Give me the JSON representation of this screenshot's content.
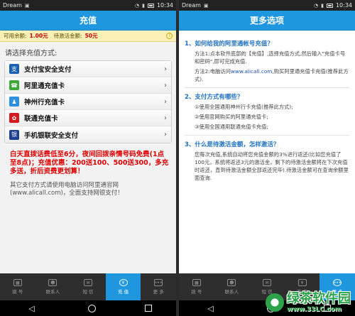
{
  "left": {
    "status": {
      "carrier": "Dream",
      "time": "10:34"
    },
    "title": "充值",
    "balance": {
      "label1": "可用余额:",
      "amount1": "1.00元",
      "label2": "待激活金额:",
      "amount2": "50元",
      "help": "?"
    },
    "section_label": "请选择充值方式:",
    "pay_methods": [
      {
        "label": "支付宝安全支付",
        "icon": "alipay-shield-icon",
        "icon_glyph": "支",
        "color": "#1a5fb4"
      },
      {
        "label": "阿里通充值卡",
        "icon": "phone-card-icon",
        "icon_glyph": "☎",
        "color": "#3aa935"
      },
      {
        "label": "神州行充值卡",
        "icon": "person-card-icon",
        "icon_glyph": "♟",
        "color": "#2d8fe0"
      },
      {
        "label": "联通充值卡",
        "icon": "unicom-knot-icon",
        "icon_glyph": "✿",
        "color": "#d71920"
      },
      {
        "label": "手机银联安全支付",
        "icon": "unionpay-card-icon",
        "icon_glyph": "银",
        "color": "#1d3f8f"
      }
    ],
    "promo": "白天直拨话费低至6分，夜间回拨亲情号码免费(1点至8点)；充值优惠：200送100、500送300，多充多送，折后资费更划算！",
    "note": "其它支付方式请使用电脑访问阿里通官网(www.alicall.com)，全面支持网银支付！",
    "tabs": [
      {
        "label": "拨 号",
        "glyph": "▦",
        "active": false
      },
      {
        "label": "联系人",
        "glyph": "☻",
        "active": false
      },
      {
        "label": "短 信",
        "glyph": "✉",
        "active": false
      },
      {
        "label": "充 值",
        "glyph": "¥",
        "active": true
      },
      {
        "label": "更 多",
        "glyph": "•••",
        "active": false
      }
    ]
  },
  "right": {
    "status": {
      "carrier": "Dream",
      "time": "10:34"
    },
    "title": "更多选项",
    "faq": [
      {
        "q": "1、如何给我的阿里通帐号充值？",
        "a": [
          {
            "t": "方法1:点本软件底部的【充值】,选择充值方式,然后输入\"充值卡号和密码\",即可完成充值."
          },
          {
            "t": "方法2:电脑访问",
            "link": "www.alicall.com",
            "t2": ",购买阿里通充值卡充值(推荐此方式)."
          }
        ]
      },
      {
        "q": "2、支付方式有哪些？",
        "a": [
          {
            "t": "①使用全国通用神州行卡充值(推荐此方式);"
          },
          {
            "t": "②使用官网购买的阿里通充值卡;"
          },
          {
            "t": "③使用全国通用联通充值卡充值;"
          }
        ]
      },
      {
        "q": "3、什么是待激活金额，怎样激活？",
        "a": [
          {
            "t": "您每次充值,系统自动将您充值金额的3%进行返还(比如您充值了100元，系统将返还3元的激活金，剩下的待激活金额将在下次充值时返还，直到待激活金额全部返还完毕).待激活金额可在查询余额里面查询."
          }
        ]
      }
    ]
  },
  "watermark": {
    "title": "绿茶软件园",
    "url": "www.33LC.com"
  }
}
